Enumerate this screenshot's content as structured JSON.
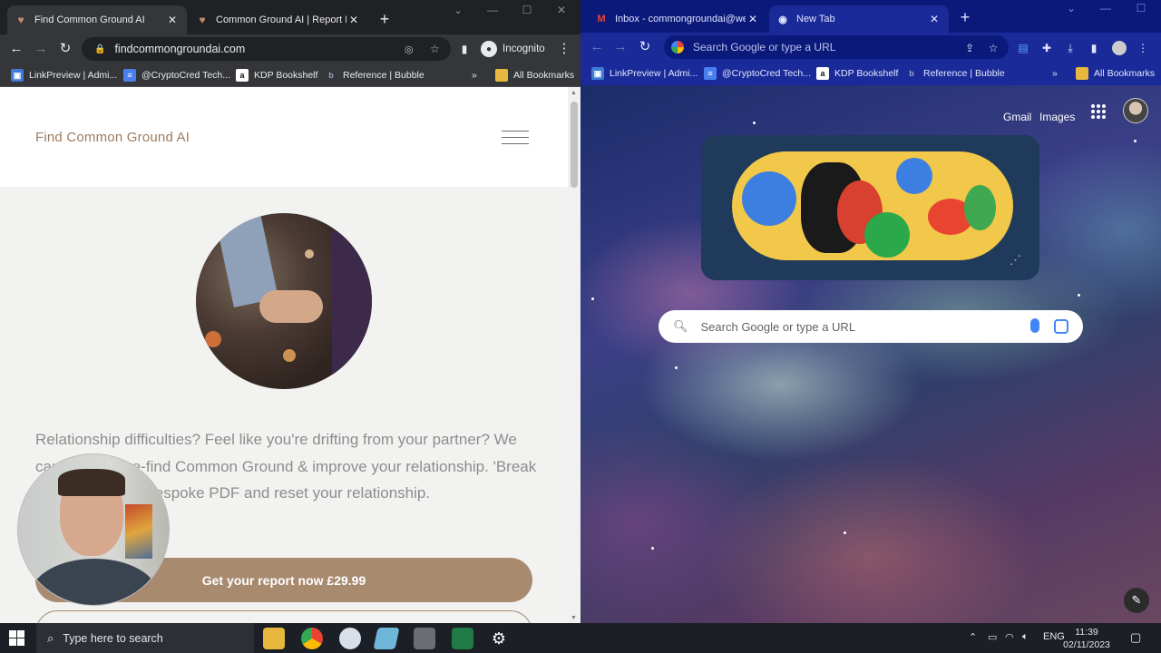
{
  "left_browser": {
    "tabs": [
      {
        "title": "Find Common Ground AI",
        "active": true
      },
      {
        "title": "Common Ground AI | Report Bu",
        "active": false
      }
    ],
    "url": "findcommongroundai.com",
    "incognito_label": "Incognito",
    "bookmarks": [
      "LinkPreview | Admi...",
      "@CryptoCred Tech...",
      "KDP Bookshelf",
      "Reference | Bubble"
    ],
    "all_bookmarks": "All Bookmarks",
    "more_glyph": "»"
  },
  "site": {
    "brand": "Find Common Ground AI",
    "lead_text": "Relationship difficulties? Feel like you're drifting from your partner? We can help you re-find Common Ground & improve your relationship. 'Break the ice' with our bespoke PDF and reset your relationship.",
    "cta_label": "Get your report now £29.99"
  },
  "right_browser": {
    "tabs": [
      {
        "title": "Inbox - commongroundai@well",
        "active": false
      },
      {
        "title": "New Tab",
        "active": true
      }
    ],
    "omnibox_placeholder": "Search Google or type a URL",
    "bookmarks": [
      "LinkPreview | Admi...",
      "@CryptoCred Tech...",
      "KDP Bookshelf",
      "Reference | Bubble"
    ],
    "all_bookmarks": "All Bookmarks",
    "more_glyph": "»"
  },
  "newtab": {
    "gmail": "Gmail",
    "images": "Images",
    "search_placeholder": "Search Google or type a URL"
  },
  "taskbar": {
    "search_placeholder": "Type here to search",
    "language": "ENG",
    "time": "11:39",
    "date": "02/11/2023"
  },
  "colors": {
    "brand": "#9b7b60",
    "cta": "#a88a6f",
    "right_theme": "#1a2a98"
  }
}
